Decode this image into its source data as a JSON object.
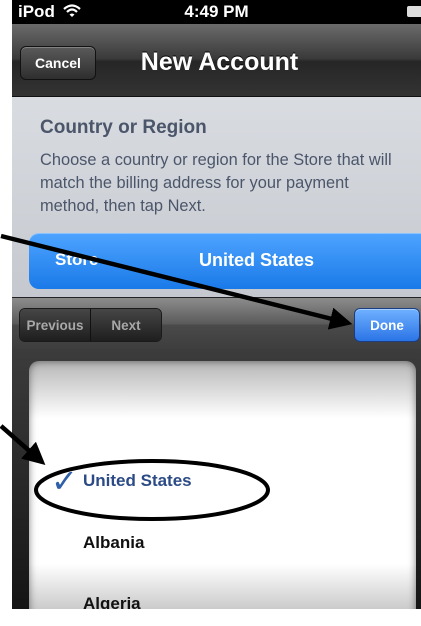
{
  "status_bar": {
    "carrier": "iPod",
    "time": "4:49 PM"
  },
  "nav": {
    "cancel_label": "Cancel",
    "title": "New Account"
  },
  "content": {
    "heading": "Country or Region",
    "description": "Choose a country or region for the Store that will match the billing address for your payment method, then tap Next.",
    "store_label": "Store",
    "store_value": "United States"
  },
  "toolbar": {
    "previous_label": "Previous",
    "next_label": "Next",
    "done_label": "Done"
  },
  "picker": {
    "items": [
      {
        "label": "United States",
        "selected": true
      },
      {
        "label": "Albania",
        "selected": false
      },
      {
        "label": "Algeria",
        "selected": false
      }
    ]
  },
  "icons": [
    "wifi-icon",
    "battery-icon",
    "checkmark-icon"
  ],
  "colors": {
    "accent_blue": "#1a7ae8",
    "done_blue": "#2b74e6",
    "annotation": "#000000"
  }
}
